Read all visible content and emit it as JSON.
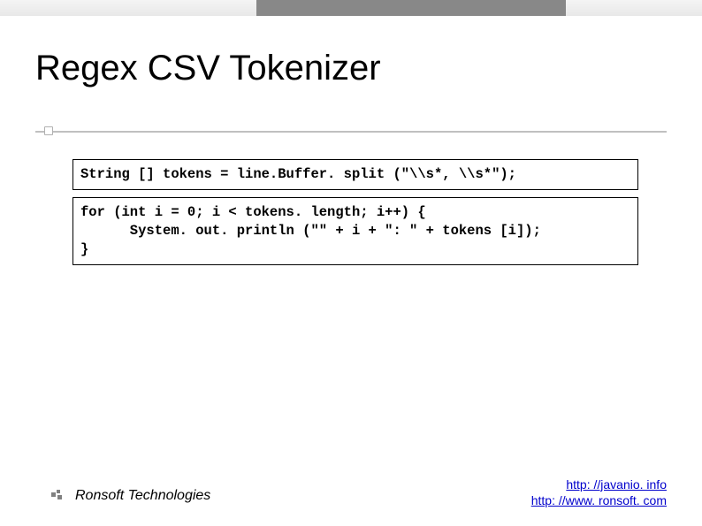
{
  "title": "Regex CSV Tokenizer",
  "code": {
    "line1": "String [] tokens = line.Buffer. split (\"\\\\s*, \\\\s*\");",
    "block2_l1": "for (int i = 0; i < tokens. length; i++) {",
    "block2_l2": "      System. out. println (\"\" + i + \": \" + tokens [i]);",
    "block2_l3": "}"
  },
  "footer": {
    "company": "Ronsoft Technologies",
    "link1": "http: //javanio. info",
    "link2": "http: //www. ronsoft. com"
  }
}
